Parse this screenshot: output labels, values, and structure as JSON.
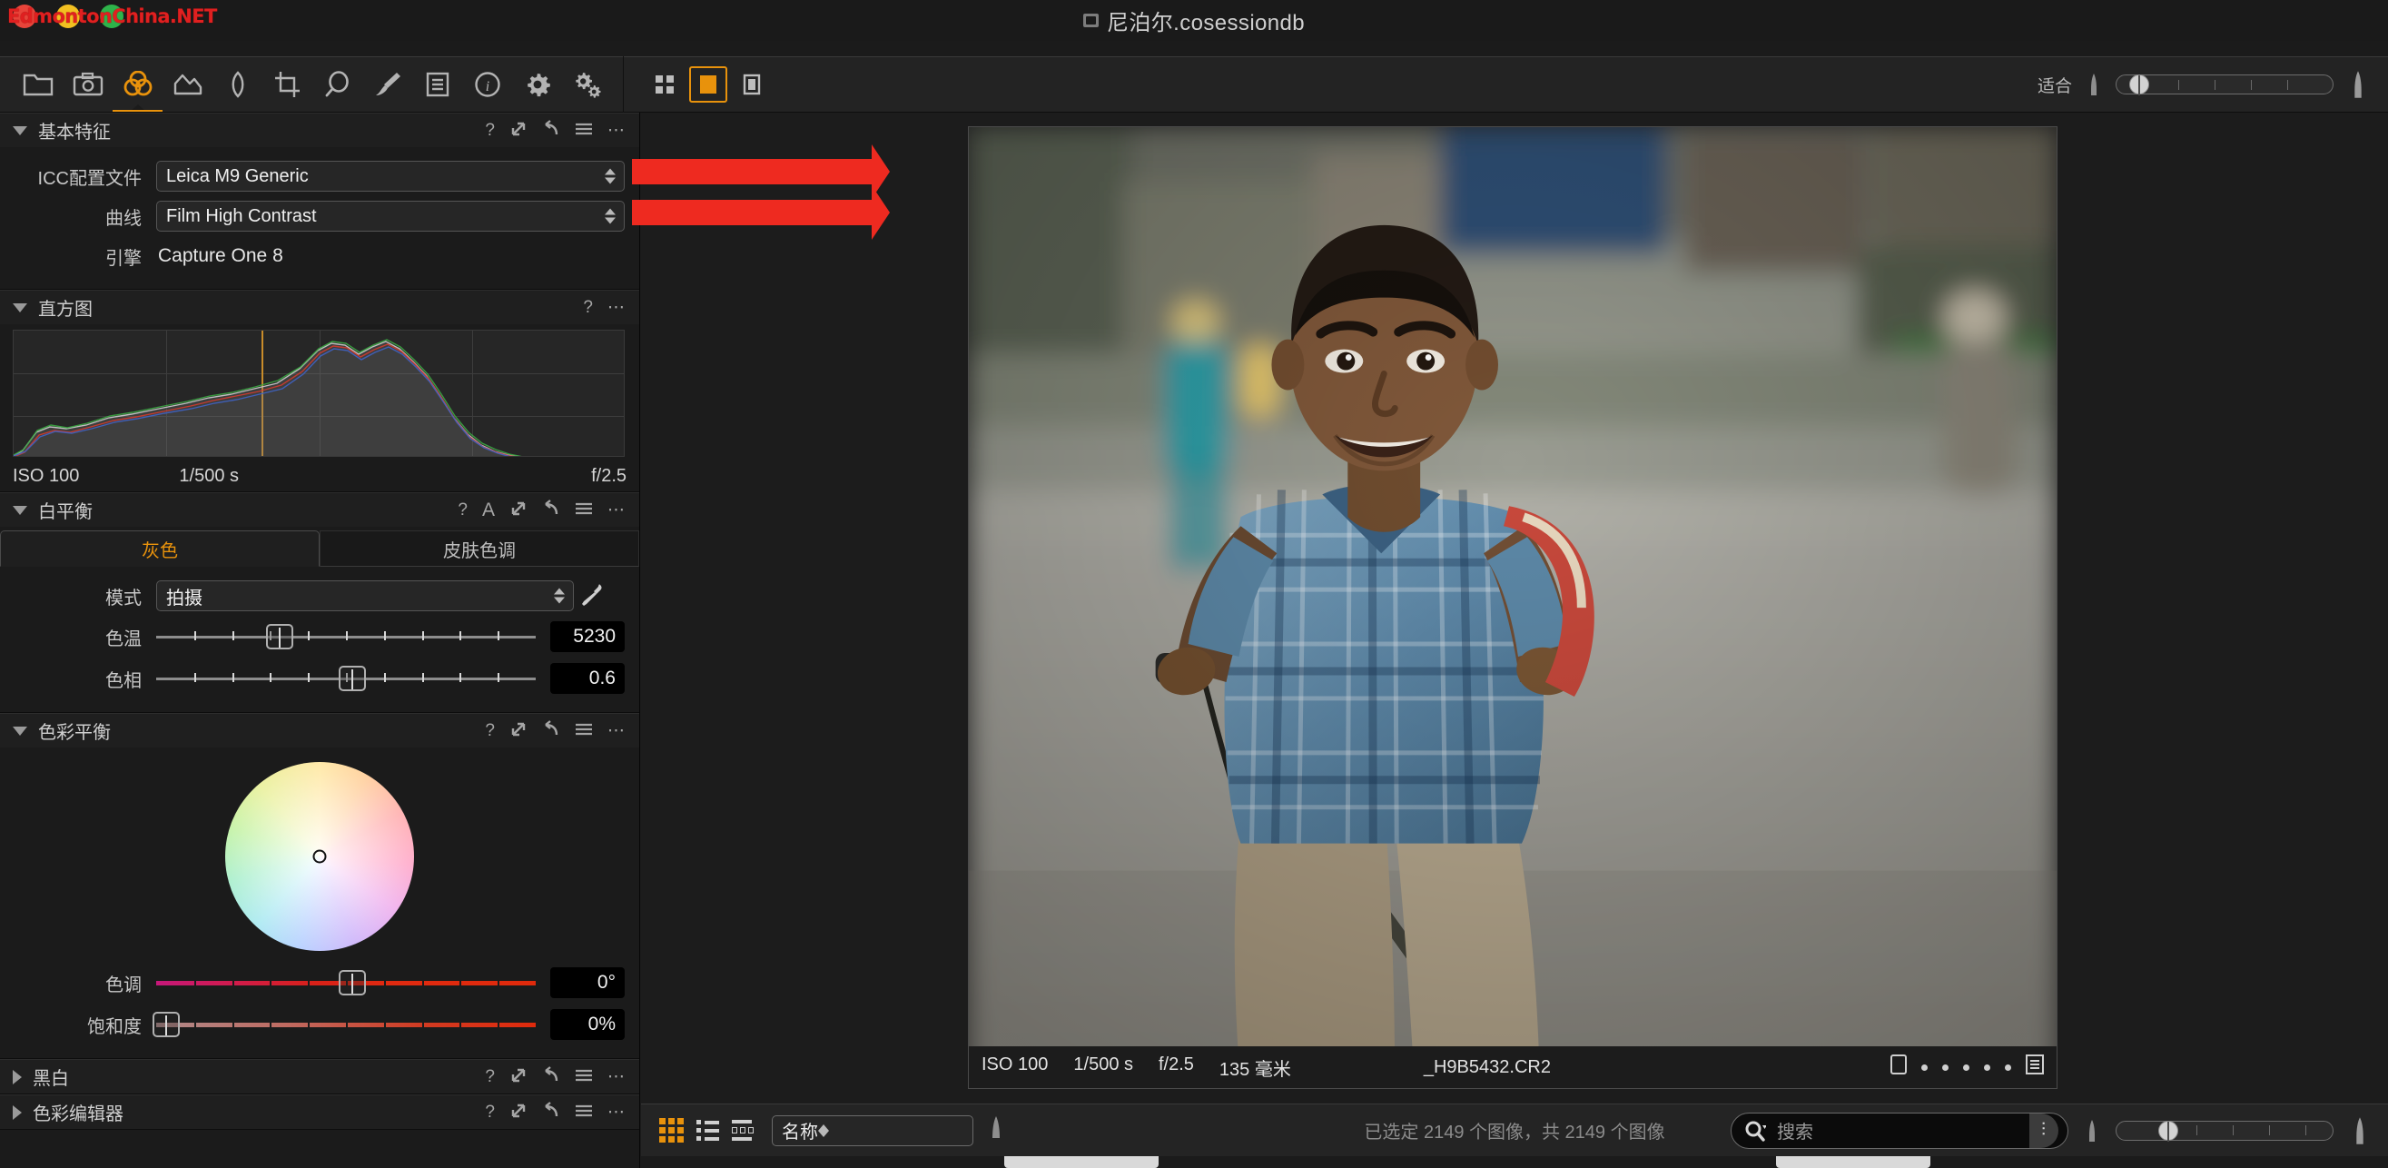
{
  "window": {
    "title": "尼泊尔.cosessiondb",
    "watermark": "EdmontonChina.NET"
  },
  "toolbar": {
    "tools": [
      {
        "name": "library-tool",
        "icon": "folder-icon",
        "active": false
      },
      {
        "name": "capture-tool",
        "icon": "camera-icon",
        "active": false
      },
      {
        "name": "color-tool",
        "icon": "color-circles-icon",
        "active": true
      },
      {
        "name": "exposure-tool",
        "icon": "histogram-icon",
        "active": false
      },
      {
        "name": "lens-tool",
        "icon": "lens-icon",
        "active": false
      },
      {
        "name": "composition-tool",
        "icon": "crop-icon",
        "active": false
      },
      {
        "name": "details-tool",
        "icon": "magnifier-icon",
        "active": false
      },
      {
        "name": "adjustments-tool",
        "icon": "brush-icon",
        "active": false
      },
      {
        "name": "metadata-tool",
        "icon": "document-lines-icon",
        "active": false
      },
      {
        "name": "info-tool",
        "icon": "info-circle-icon",
        "active": false
      },
      {
        "name": "output-tool",
        "icon": "gear-icon",
        "active": false
      },
      {
        "name": "batch-tool",
        "icon": "gears-icon",
        "active": false
      }
    ],
    "view_modes": [
      {
        "name": "grid-view-button",
        "selected": false
      },
      {
        "name": "single-view-button",
        "selected": true
      },
      {
        "name": "detail-view-button",
        "selected": false
      }
    ],
    "fit_label": "适合",
    "zoom_value": 12
  },
  "panels": {
    "base_characteristics": {
      "title": "基本特征",
      "expanded": true,
      "header_icons": [
        "help-icon",
        "expand-icon",
        "reset-icon",
        "menu-icon",
        "more-icon"
      ],
      "fields": [
        {
          "label": "ICC配置文件",
          "value": "Leica M9 Generic",
          "type": "combo"
        },
        {
          "label": "曲线",
          "value": "Film High Contrast",
          "type": "combo"
        },
        {
          "label": "引擎",
          "value": "Capture One 8",
          "type": "static"
        }
      ]
    },
    "histogram": {
      "title": "直方图",
      "expanded": true,
      "header_icons": [
        "help-icon",
        "more-icon"
      ],
      "exif": {
        "iso": "ISO 100",
        "shutter": "1/500 s",
        "aperture": "f/2.5"
      }
    },
    "white_balance": {
      "title": "白平衡",
      "expanded": true,
      "header_icons": [
        "help-icon",
        "auto-icon",
        "expand-icon",
        "reset-icon",
        "menu-icon",
        "more-icon"
      ],
      "tabs": [
        {
          "label": "灰色",
          "active": true
        },
        {
          "label": "皮肤色调",
          "active": false
        }
      ],
      "mode": {
        "label": "模式",
        "value": "拍摄"
      },
      "sliders": [
        {
          "label": "色温",
          "value": "5230",
          "pos_pct": 31
        },
        {
          "label": "色相",
          "value": "0.6",
          "pos_pct": 52
        }
      ],
      "picker": "eyedropper-icon"
    },
    "color_balance": {
      "title": "色彩平衡",
      "expanded": true,
      "header_icons": [
        "help-icon",
        "expand-icon",
        "reset-icon",
        "menu-icon",
        "more-icon"
      ],
      "wheel": {
        "name": "color-wheel",
        "handle_x_pct": 50,
        "handle_y_pct": 50
      },
      "sliders": [
        {
          "label": "色调",
          "value": "0°",
          "pos_pct": 50
        },
        {
          "label": "饱和度",
          "value": "0%",
          "pos_pct": 0
        }
      ]
    },
    "black_white": {
      "title": "黑白",
      "expanded": false,
      "header_icons": [
        "help-icon",
        "expand-icon",
        "reset-icon",
        "menu-icon",
        "more-icon"
      ]
    },
    "color_editor": {
      "title": "色彩编辑器",
      "expanded": false,
      "header_icons": [
        "help-icon",
        "expand-icon",
        "reset-icon",
        "menu-icon",
        "more-icon"
      ]
    }
  },
  "viewer": {
    "image_info": {
      "iso": "ISO 100",
      "shutter": "1/500 s",
      "aperture": "f/2.5",
      "focal": "135 毫米",
      "filename": "_H9B5432.CR2",
      "rating_dots": 5
    }
  },
  "bottom_bar": {
    "view_buttons": [
      "grid-browser-button",
      "list-browser-button",
      "filmstrip-browser-button"
    ],
    "sort": {
      "value": "名称"
    },
    "sort_direction": "ascending",
    "selection_status": "已选定 2149 个图像，共 2149 个图像",
    "search": {
      "placeholder": "搜索",
      "value": ""
    },
    "thumb_size": 22
  },
  "colors": {
    "accent": "#e8920c",
    "panel_bg": "#1b1b1b",
    "toolbar_bg": "#232323",
    "text": "#cfcfcf",
    "annotation_arrow": "#ee2a20"
  },
  "annotations": [
    {
      "name": "arrow-to-icc-profile",
      "target": "ICC配置文件"
    },
    {
      "name": "arrow-to-curve",
      "target": "曲线"
    }
  ]
}
